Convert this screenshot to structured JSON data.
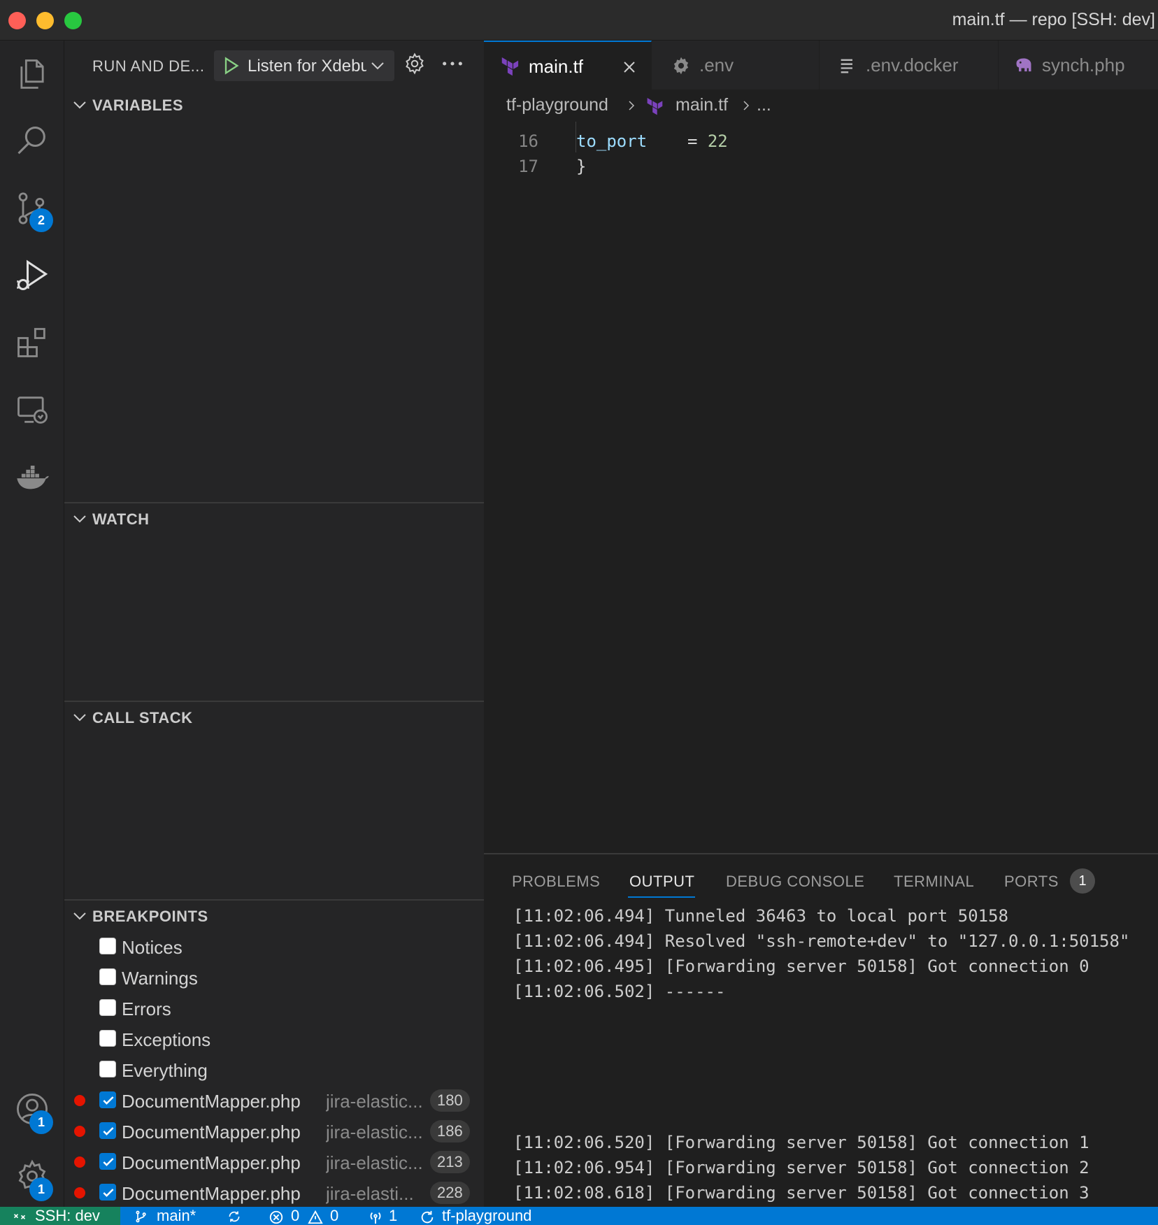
{
  "window": {
    "title": "main.tf — repo [SSH: dev]",
    "traffic_lights": [
      "#ff5f57",
      "#febc2e",
      "#28c840"
    ]
  },
  "activity_bar": {
    "items": [
      {
        "icon": "files-icon"
      },
      {
        "icon": "search-icon"
      },
      {
        "icon": "source-control-icon",
        "badge": "2"
      },
      {
        "icon": "run-debug-icon",
        "active": true
      },
      {
        "icon": "extensions-icon"
      },
      {
        "icon": "remote-explorer-icon"
      },
      {
        "icon": "docker-icon"
      }
    ],
    "accounts_badge": "1",
    "manage_badge": "1"
  },
  "sidebar": {
    "title": "RUN AND DE...",
    "launch_config": "Listen for Xdebug",
    "sections": {
      "variables": "VARIABLES",
      "watch": "WATCH",
      "call_stack": "CALL STACK",
      "breakpoints": "BREAKPOINTS"
    },
    "exception_breakpoints": [
      {
        "label": "Notices",
        "checked": false
      },
      {
        "label": "Warnings",
        "checked": false
      },
      {
        "label": "Errors",
        "checked": false
      },
      {
        "label": "Exceptions",
        "checked": false
      },
      {
        "label": "Everything",
        "checked": false
      }
    ],
    "breakpoints": [
      {
        "file": "DocumentMapper.php",
        "path": "jira-elastic...",
        "line": "180"
      },
      {
        "file": "DocumentMapper.php",
        "path": "jira-elastic...",
        "line": "186"
      },
      {
        "file": "DocumentMapper.php",
        "path": "jira-elastic...",
        "line": "213"
      },
      {
        "file": "DocumentMapper.php",
        "path": "jira-elasti...",
        "line": "228"
      }
    ]
  },
  "editor": {
    "tabs": [
      {
        "label": "main.tf",
        "icon": "terraform-icon",
        "active": true
      },
      {
        "label": ".env",
        "icon": "gear-icon"
      },
      {
        "label": ".env.docker",
        "icon": "lines-icon"
      },
      {
        "label": "synch.php",
        "icon": "php-elephant-icon"
      }
    ],
    "breadcrumb": [
      "tf-playground",
      "main.tf",
      "..."
    ],
    "lines": [
      {
        "num": "16",
        "key": "to_port",
        "op": "= ",
        "value": "22"
      },
      {
        "num": "17",
        "text": "}"
      }
    ]
  },
  "panel": {
    "tabs": [
      "PROBLEMS",
      "OUTPUT",
      "DEBUG CONSOLE",
      "TERMINAL",
      "PORTS"
    ],
    "active_tab": "OUTPUT",
    "ports_badge": "1",
    "output_lines": [
      "[11:02:06.494] Tunneled 36463 to local port 50158",
      "[11:02:06.494] Resolved \"ssh-remote+dev\" to \"127.0.0.1:50158\"",
      "[11:02:06.495] [Forwarding server 50158] Got connection 0",
      "[11:02:06.502] ------",
      "[11:02:06.520] [Forwarding server 50158] Got connection 1",
      "[11:02:06.954] [Forwarding server 50158] Got connection 2",
      "[11:02:08.618] [Forwarding server 50158] Got connection 3"
    ]
  },
  "status_bar": {
    "remote": "SSH: dev",
    "branch": "main*",
    "errors": "0",
    "warnings": "0",
    "ports": "1",
    "folder": "tf-playground"
  },
  "colors": {
    "accent": "#0078d4",
    "remote_bg": "#16825d",
    "breakpoint": "#e51400",
    "terraform": "#7b42bc",
    "code_key": "#9cdcfe",
    "code_number": "#b5cea8"
  }
}
